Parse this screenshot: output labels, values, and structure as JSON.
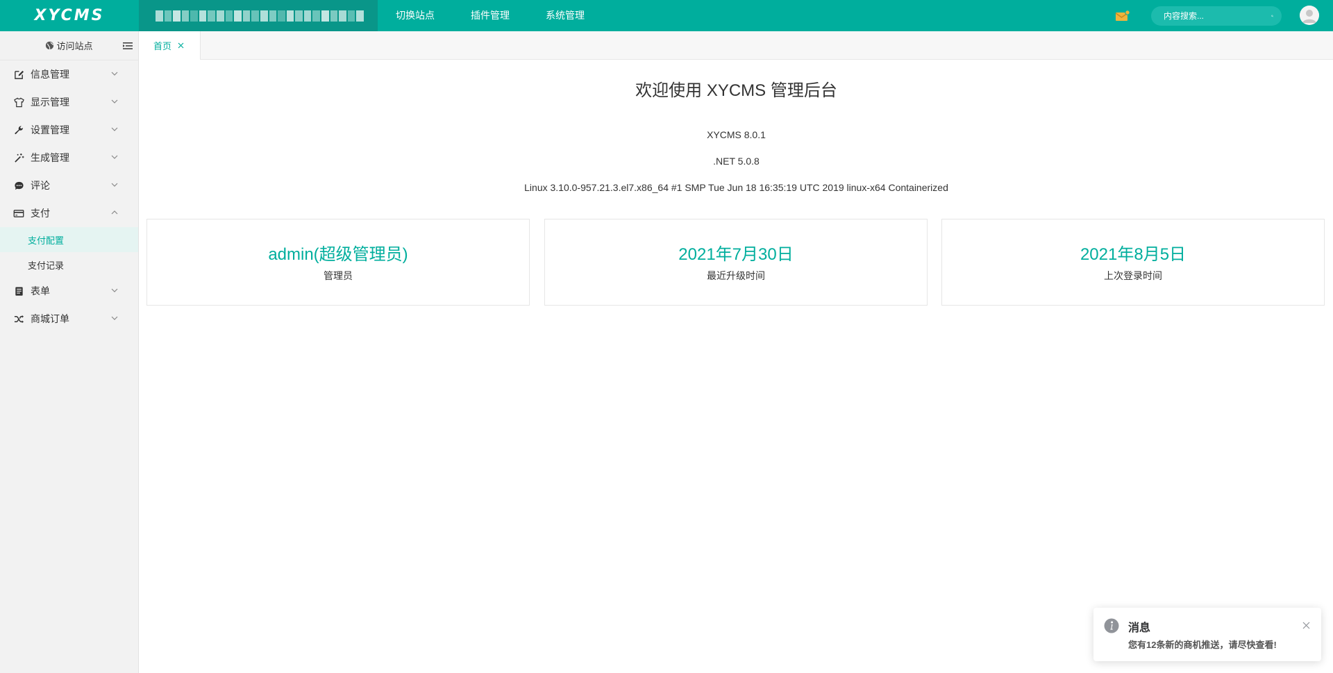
{
  "app": {
    "logo_text": "XYCMS"
  },
  "topnav": {
    "items": [
      {
        "label": "切换站点"
      },
      {
        "label": "插件管理"
      },
      {
        "label": "系统管理"
      }
    ]
  },
  "search": {
    "placeholder": "内容搜索..."
  },
  "icons": {
    "mail": "mail-icon",
    "search": "search-icon",
    "avatar": "user-avatar-icon"
  },
  "colors": {
    "brand": "#00ae9d",
    "brand_dark": "#099689",
    "mail": "#f0b43c"
  },
  "sidebar": {
    "visit_label": "访问站点",
    "items": [
      {
        "label": "信息管理",
        "icon": "edit-icon",
        "expanded": false
      },
      {
        "label": "显示管理",
        "icon": "shirt-icon",
        "expanded": false
      },
      {
        "label": "设置管理",
        "icon": "wrench-icon",
        "expanded": false
      },
      {
        "label": "生成管理",
        "icon": "magic-wand-icon",
        "expanded": false
      },
      {
        "label": "评论",
        "icon": "comment-icon",
        "expanded": false
      },
      {
        "label": "支付",
        "icon": "credit-card-icon",
        "expanded": true,
        "children": [
          {
            "label": "支付配置",
            "active": true
          },
          {
            "label": "支付记录",
            "active": false
          }
        ]
      },
      {
        "label": "表单",
        "icon": "form-icon",
        "expanded": false
      },
      {
        "label": "商城订单",
        "icon": "shuffle-icon",
        "expanded": false
      }
    ]
  },
  "tabs": [
    {
      "label": "首页",
      "active": true
    }
  ],
  "main": {
    "welcome": "欢迎使用 XYCMS 管理后台",
    "version": "XYCMS 8.0.1",
    "runtime": ".NET 5.0.8",
    "os": "Linux 3.10.0-957.21.3.el7.x86_64 #1 SMP Tue Jun 18 16:35:19 UTC 2019 linux-x64 Containerized",
    "cards": [
      {
        "value": "admin(超级管理员)",
        "label": "管理员"
      },
      {
        "value": "2021年7月30日",
        "label": "最近升级时间"
      },
      {
        "value": "2021年8月5日",
        "label": "上次登录时间"
      }
    ]
  },
  "notification": {
    "title": "消息",
    "text": "您有12条新的商机推送，请尽快查看!"
  }
}
